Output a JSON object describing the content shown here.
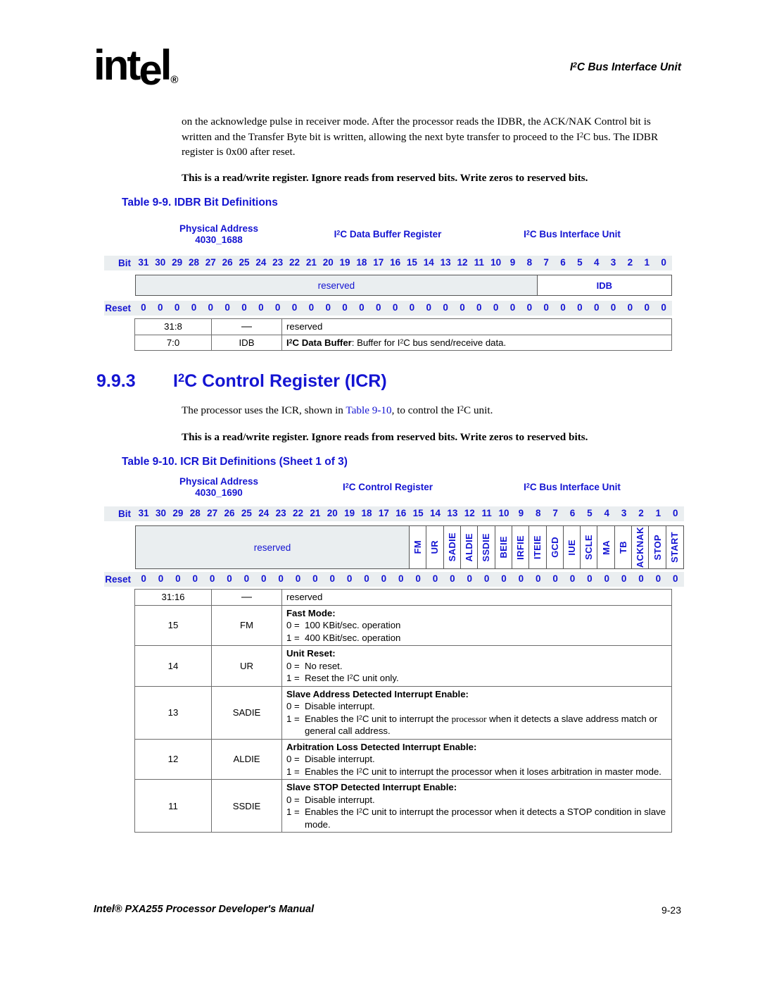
{
  "header": {
    "logo_text": "intel",
    "logo_reg": "®",
    "running_head": "I2C Bus Interface Unit"
  },
  "intro_paragraph": "on the acknowledge pulse in receiver mode. After the processor reads the IDBR, the ACK/NAK Control bit is written and the Transfer Byte bit is written, allowing the next byte transfer to proceed to the I2C bus. The IDBR register is 0x00 after reset.",
  "rw_note_1": "This is a read/write register. Ignore reads from reserved bits. Write zeros to reserved bits.",
  "table_9_9": {
    "caption": "Table 9-9.  IDBR Bit Definitions",
    "physical_address_label": "Physical Address",
    "physical_address_value": "4030_1688",
    "register_name": "I2C Data Buffer Register",
    "unit_name": "I2C Bus Interface Unit",
    "bit_label": "Bit",
    "reset_label": "Reset",
    "bit_numbers": [
      "31",
      "30",
      "29",
      "28",
      "27",
      "26",
      "25",
      "24",
      "23",
      "22",
      "21",
      "20",
      "19",
      "18",
      "17",
      "16",
      "15",
      "14",
      "13",
      "12",
      "11",
      "10",
      "9",
      "8",
      "7",
      "6",
      "5",
      "4",
      "3",
      "2",
      "1",
      "0"
    ],
    "reset_values": [
      "0",
      "0",
      "0",
      "0",
      "0",
      "0",
      "0",
      "0",
      "0",
      "0",
      "0",
      "0",
      "0",
      "0",
      "0",
      "0",
      "0",
      "0",
      "0",
      "0",
      "0",
      "0",
      "0",
      "0",
      "0",
      "0",
      "0",
      "0",
      "0",
      "0",
      "0",
      "0"
    ],
    "fields": [
      {
        "name": "reserved",
        "bits": 24,
        "reserved": true,
        "orientation": "horizontal"
      },
      {
        "name": "IDB",
        "bits": 8,
        "reserved": false,
        "orientation": "horizontal"
      }
    ],
    "rows": [
      {
        "bits": "31:8",
        "mnemonic": "—",
        "title": "",
        "body": "reserved",
        "options": []
      },
      {
        "bits": "7:0",
        "mnemonic": "IDB",
        "title": "I2C Data Buffer",
        "title_suffix": ": Buffer for I2C bus send/receive data.",
        "body": "",
        "options": []
      }
    ]
  },
  "section": {
    "number": "9.9.3",
    "title": "I2C Control Register (ICR)",
    "paragraph_pre": "The processor uses the ICR, shown in ",
    "paragraph_xref": "Table 9-10",
    "paragraph_post": ", to control the I2C unit."
  },
  "rw_note_2": "This is a read/write register. Ignore reads from reserved bits. Write zeros to reserved bits.",
  "table_9_10": {
    "caption": "Table 9-10.  ICR Bit Definitions (Sheet 1 of 3)",
    "physical_address_label": "Physical Address",
    "physical_address_value": "4030_1690",
    "register_name": "I2C Control Register",
    "unit_name": "I2C Bus Interface Unit",
    "bit_label": "Bit",
    "reset_label": "Reset",
    "bit_numbers": [
      "31",
      "30",
      "29",
      "28",
      "27",
      "26",
      "25",
      "24",
      "23",
      "22",
      "21",
      "20",
      "19",
      "18",
      "17",
      "16",
      "15",
      "14",
      "13",
      "12",
      "11",
      "10",
      "9",
      "8",
      "7",
      "6",
      "5",
      "4",
      "3",
      "2",
      "1",
      "0"
    ],
    "reset_values": [
      "0",
      "0",
      "0",
      "0",
      "0",
      "0",
      "0",
      "0",
      "0",
      "0",
      "0",
      "0",
      "0",
      "0",
      "0",
      "0",
      "0",
      "0",
      "0",
      "0",
      "0",
      "0",
      "0",
      "0",
      "0",
      "0",
      "0",
      "0",
      "0",
      "0",
      "0",
      "0"
    ],
    "fields": [
      {
        "name": "reserved",
        "bits": 16,
        "reserved": true,
        "orientation": "horizontal"
      },
      {
        "name": "FM",
        "bits": 1,
        "reserved": false,
        "orientation": "vertical"
      },
      {
        "name": "UR",
        "bits": 1,
        "reserved": false,
        "orientation": "vertical"
      },
      {
        "name": "SADIE",
        "bits": 1,
        "reserved": false,
        "orientation": "vertical"
      },
      {
        "name": "ALDIE",
        "bits": 1,
        "reserved": false,
        "orientation": "vertical"
      },
      {
        "name": "SSDIE",
        "bits": 1,
        "reserved": false,
        "orientation": "vertical"
      },
      {
        "name": "BEIE",
        "bits": 1,
        "reserved": false,
        "orientation": "vertical"
      },
      {
        "name": "IRFIE",
        "bits": 1,
        "reserved": false,
        "orientation": "vertical"
      },
      {
        "name": "ITEIE",
        "bits": 1,
        "reserved": false,
        "orientation": "vertical"
      },
      {
        "name": "GCD",
        "bits": 1,
        "reserved": false,
        "orientation": "vertical"
      },
      {
        "name": "IUE",
        "bits": 1,
        "reserved": false,
        "orientation": "vertical"
      },
      {
        "name": "SCLE",
        "bits": 1,
        "reserved": false,
        "orientation": "vertical"
      },
      {
        "name": "MA",
        "bits": 1,
        "reserved": false,
        "orientation": "vertical"
      },
      {
        "name": "TB",
        "bits": 1,
        "reserved": false,
        "orientation": "vertical"
      },
      {
        "name": "ACKNAK",
        "bits": 1,
        "reserved": false,
        "orientation": "vertical"
      },
      {
        "name": "STOP",
        "bits": 1,
        "reserved": false,
        "orientation": "vertical"
      },
      {
        "name": "START",
        "bits": 1,
        "reserved": false,
        "orientation": "vertical"
      }
    ],
    "rows": [
      {
        "bits": "31:16",
        "mnemonic": "—",
        "title": "",
        "body": "reserved",
        "options": []
      },
      {
        "bits": "15",
        "mnemonic": "FM",
        "title": "Fast Mode:",
        "options": [
          {
            "key": "0 =",
            "value": "100 KBit/sec. operation"
          },
          {
            "key": "1 =",
            "value": "400 KBit/sec. operation"
          }
        ]
      },
      {
        "bits": "14",
        "mnemonic": "UR",
        "title": "Unit Reset:",
        "options": [
          {
            "key": "0 =",
            "value": "No reset."
          },
          {
            "key": "1 =",
            "value": "Reset the I2C unit only."
          }
        ]
      },
      {
        "bits": "13",
        "mnemonic": "SADIE",
        "title": "Slave Address Detected Interrupt Enable:",
        "options": [
          {
            "key": "0 =",
            "value": "Disable interrupt."
          },
          {
            "key": "1 =",
            "value": "Enables the I2C unit to interrupt the processor when it detects a slave address match or general call address."
          }
        ]
      },
      {
        "bits": "12",
        "mnemonic": "ALDIE",
        "title": "Arbitration Loss Detected Interrupt Enable:",
        "options": [
          {
            "key": "0 =",
            "value": "Disable interrupt."
          },
          {
            "key": "1 =",
            "value": "Enables the I2C unit to interrupt the processor when it loses arbitration in master mode."
          }
        ]
      },
      {
        "bits": "11",
        "mnemonic": "SSDIE",
        "title": "Slave STOP Detected Interrupt Enable:",
        "options": [
          {
            "key": "0 =",
            "value": "Disable interrupt."
          },
          {
            "key": "1 =",
            "value": "Enables the I2C unit to interrupt the processor when it detects a STOP condition in slave mode."
          }
        ]
      }
    ]
  },
  "footer": {
    "left": "Intel® PXA255 Processor Developer's Manual",
    "right": "9-23"
  },
  "colors": {
    "heading_blue": "#1414d2",
    "reserved_fill": "#eaeef0",
    "rule_gray": "#6d6d6d"
  }
}
